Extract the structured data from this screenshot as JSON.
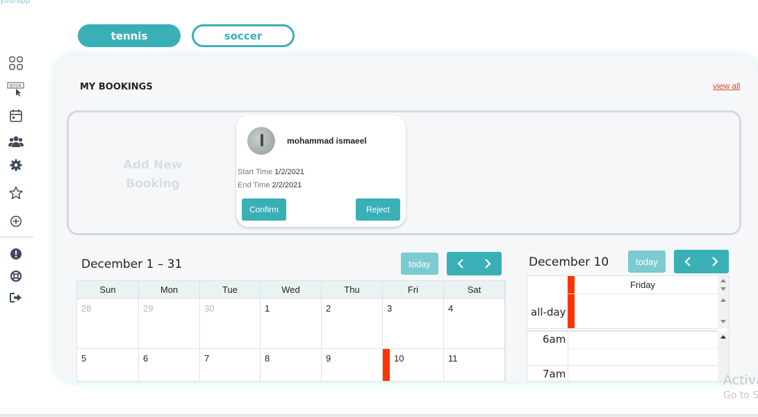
{
  "brand": "yourapp",
  "sidebar": {
    "items": [
      {
        "icon": "grid-icon"
      },
      {
        "icon": "book-icon",
        "label": "BOOK"
      },
      {
        "icon": "calendar-icon"
      },
      {
        "icon": "users-icon"
      },
      {
        "icon": "gear-icon"
      },
      {
        "icon": "star-icon"
      },
      {
        "icon": "add-circle-icon"
      },
      {
        "icon": "alert-icon"
      },
      {
        "icon": "lifebuoy-icon"
      },
      {
        "icon": "logout-icon"
      }
    ]
  },
  "tabs": [
    {
      "label": "tennis",
      "active": true
    },
    {
      "label": "soccer",
      "active": false
    }
  ],
  "bookings": {
    "title": "MY BOOKINGS",
    "view_all": "view all",
    "add_new": "Add New Booking",
    "card": {
      "name": "mohammad ismaeel",
      "start_label": "Start Time",
      "start_value": "1/2/2021",
      "end_label": "End Time",
      "end_value": "2/2/2021",
      "confirm": "Confirm",
      "reject": "Reject"
    }
  },
  "month_calendar": {
    "title": "December 1 – 31",
    "today": "today",
    "weekdays": [
      "Sun",
      "Mon",
      "Tue",
      "Wed",
      "Thu",
      "Fri",
      "Sat"
    ],
    "weeks": [
      [
        {
          "d": "28",
          "other": true
        },
        {
          "d": "29",
          "other": true
        },
        {
          "d": "30",
          "other": true
        },
        {
          "d": "1"
        },
        {
          "d": "2"
        },
        {
          "d": "3"
        },
        {
          "d": "4"
        }
      ],
      [
        {
          "d": "5"
        },
        {
          "d": "6"
        },
        {
          "d": "7"
        },
        {
          "d": "8"
        },
        {
          "d": "9"
        },
        {
          "d": "10",
          "event": true
        },
        {
          "d": "11"
        }
      ]
    ]
  },
  "day_calendar": {
    "title": "December 10",
    "today": "today",
    "day_name": "Friday",
    "all_day": "all-day",
    "times": [
      "6am",
      "7am"
    ]
  },
  "colors": {
    "accent": "#3aafb6",
    "accent_light": "#7ccbd0",
    "event": "#ff3300",
    "link": "#e0462a"
  },
  "watermark": {
    "line1": "Activate Windows",
    "line2": "Go to Settings to activate Windows."
  }
}
